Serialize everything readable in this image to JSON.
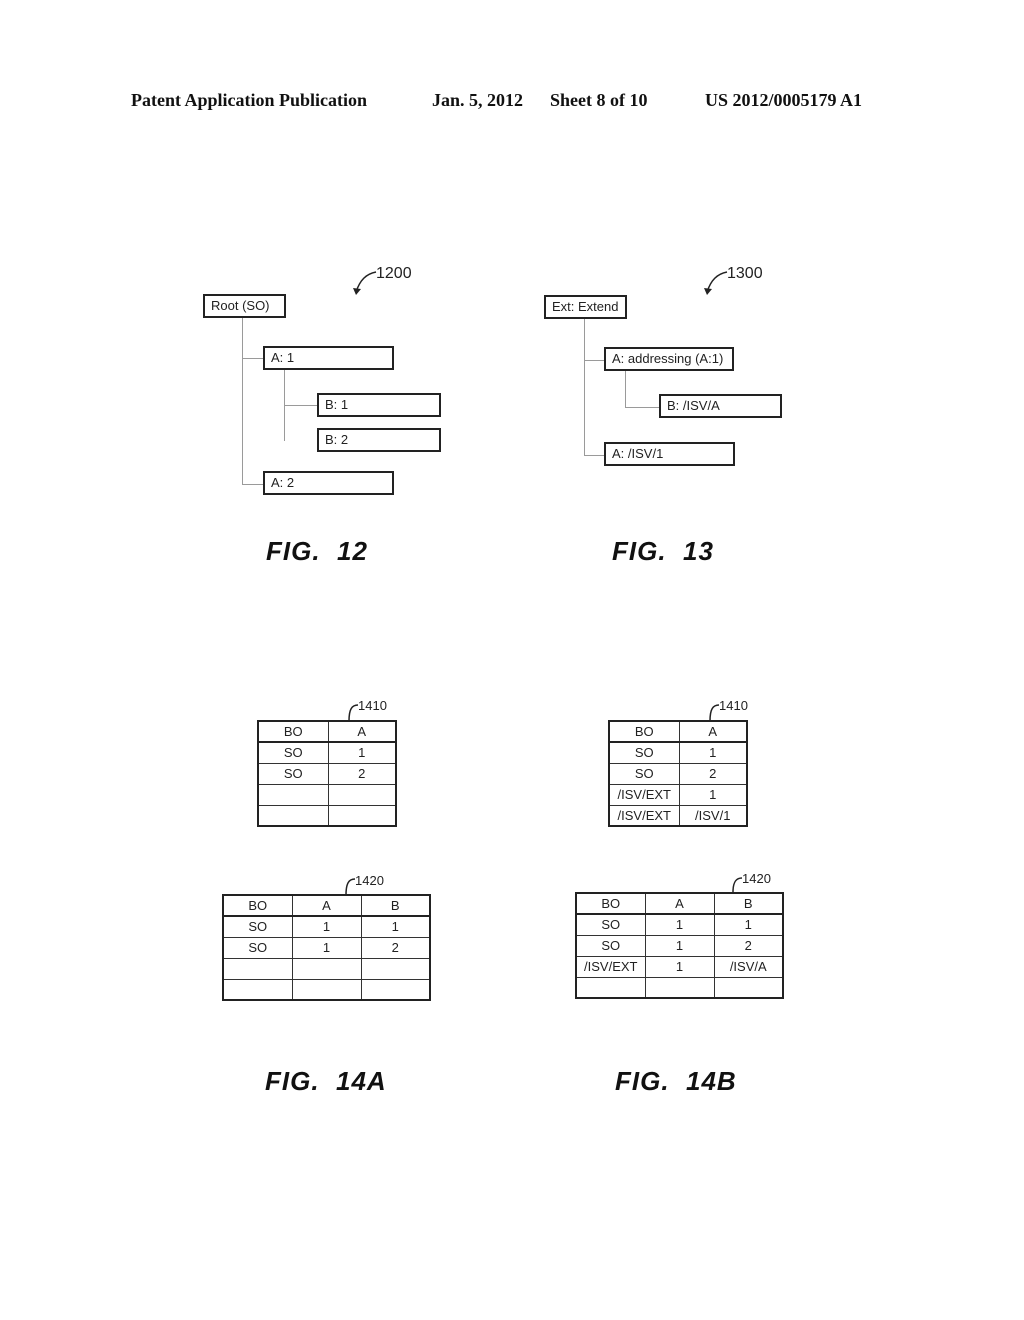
{
  "header": {
    "publication": "Patent Application Publication",
    "date": "Jan. 5, 2012",
    "sheet": "Sheet 8 of 10",
    "number": "US 2012/0005179 A1"
  },
  "fig12": {
    "ref": "1200",
    "caption": "FIG.  12",
    "nodes": {
      "root": "Root (SO)",
      "a1": "A: 1",
      "b1": "B: 1",
      "b2": "B: 2",
      "a2": "A: 2"
    }
  },
  "fig13": {
    "ref": "1300",
    "caption": "FIG.  13",
    "nodes": {
      "root": "Ext: Extend",
      "a_addr": "A: addressing (A:1)",
      "b_isv": "B: /ISV/A",
      "a_isv": "A: /ISV/1"
    }
  },
  "fig14a": {
    "caption": "FIG.  14A",
    "table1410": {
      "ref": "1410",
      "headers": [
        "BO",
        "A"
      ],
      "rows": [
        [
          "SO",
          "1"
        ],
        [
          "SO",
          "2"
        ],
        [
          "",
          ""
        ],
        [
          "",
          ""
        ]
      ]
    },
    "table1420": {
      "ref": "1420",
      "headers": [
        "BO",
        "A",
        "B"
      ],
      "rows": [
        [
          "SO",
          "1",
          "1"
        ],
        [
          "SO",
          "1",
          "2"
        ],
        [
          "",
          "",
          ""
        ],
        [
          "",
          "",
          ""
        ]
      ]
    }
  },
  "fig14b": {
    "caption": "FIG.  14B",
    "table1410": {
      "ref": "1410",
      "headers": [
        "BO",
        "A"
      ],
      "rows": [
        [
          "SO",
          "1"
        ],
        [
          "SO",
          "2"
        ],
        [
          "/ISV/EXT",
          "1"
        ],
        [
          "/ISV/EXT",
          "/ISV/1"
        ]
      ]
    },
    "table1420": {
      "ref": "1420",
      "headers": [
        "BO",
        "A",
        "B"
      ],
      "rows": [
        [
          "SO",
          "1",
          "1"
        ],
        [
          "SO",
          "1",
          "2"
        ],
        [
          "/ISV/EXT",
          "1",
          "/ISV/A"
        ],
        [
          "",
          "",
          ""
        ]
      ]
    }
  }
}
